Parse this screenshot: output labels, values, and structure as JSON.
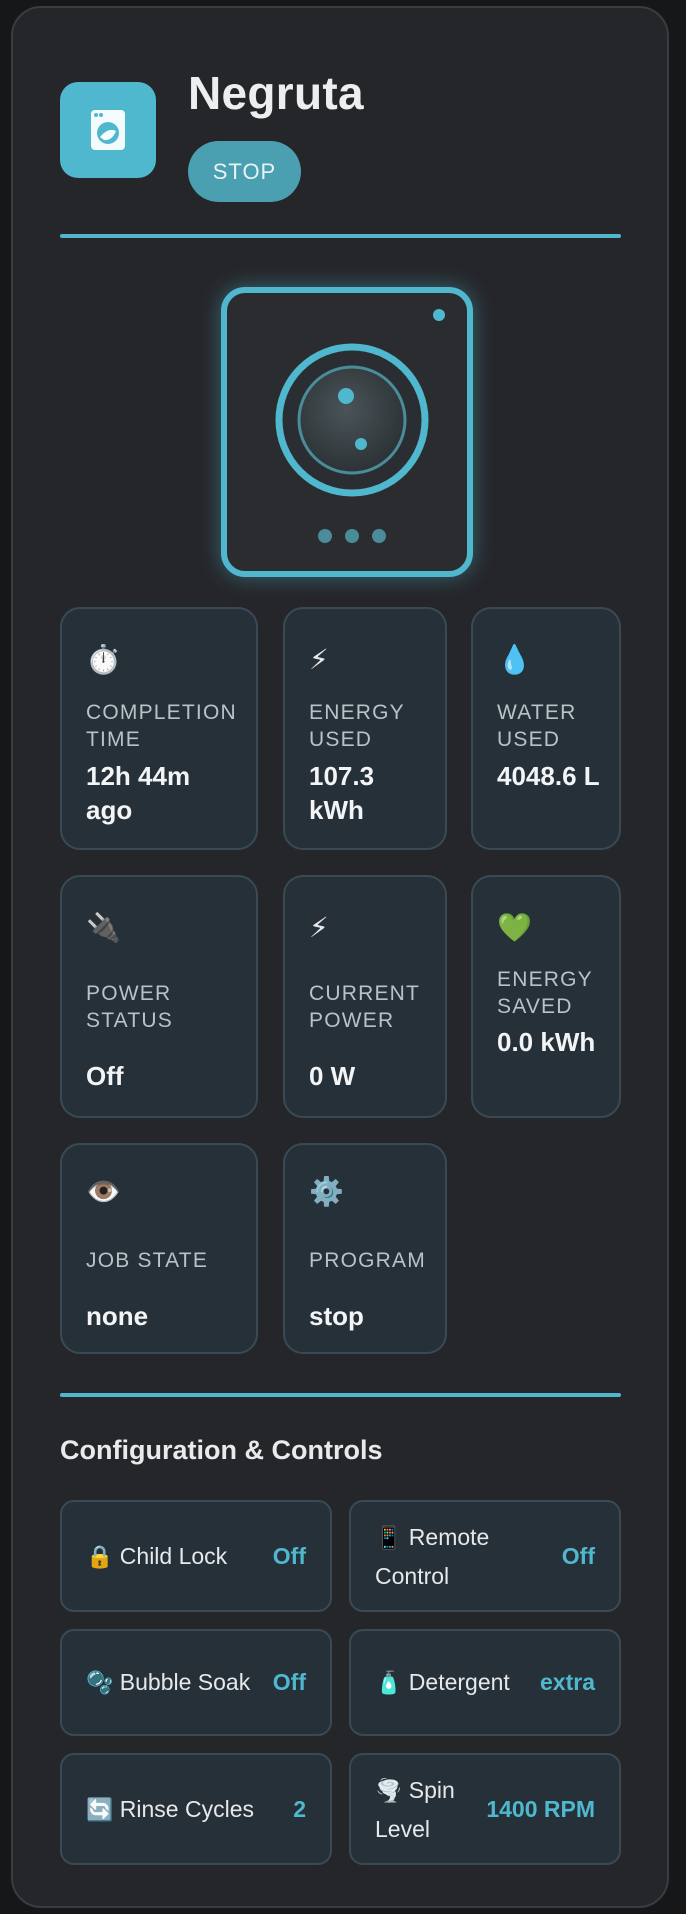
{
  "header": {
    "title": "Negruta",
    "stop_label": "STOP"
  },
  "stats": [
    {
      "icon": "⏱️",
      "label": "COMPLETION TIME",
      "value": "12h 44m ago"
    },
    {
      "icon": "⚡",
      "label": "ENERGY USED",
      "value": "107.3 kWh"
    },
    {
      "icon": "💧",
      "label": "WATER USED",
      "value": "4048.6 L"
    },
    {
      "icon": "🔌",
      "label": "POWER STATUS",
      "value": "Off"
    },
    {
      "icon": "⚡",
      "label": "CURRENT POWER",
      "value": "0 W"
    },
    {
      "icon": "💚",
      "label": "ENERGY SAVED",
      "value": "0.0 kWh"
    },
    {
      "icon": "👁️",
      "label": "JOB STATE",
      "value": "none"
    },
    {
      "icon": "⚙️",
      "label": "PROGRAM",
      "value": "stop"
    }
  ],
  "config": {
    "title": "Configuration & Controls",
    "items": [
      {
        "icon": "🔒",
        "label": "Child Lock",
        "value": "Off"
      },
      {
        "icon": "📱",
        "label": "Remote Control",
        "value": "Off"
      },
      {
        "icon": "🫧",
        "label": "Bubble Soak",
        "value": "Off"
      },
      {
        "icon": "🧴",
        "label": "Detergent",
        "value": "extra"
      },
      {
        "icon": "🔄",
        "label": "Rinse Cycles",
        "value": "2"
      },
      {
        "icon": "🌪️",
        "label": "Spin Level",
        "value": "1400 RPM"
      }
    ]
  },
  "colors": {
    "accent": "#4fb8cf",
    "card_bg": "#25262a",
    "tile_bg": "#263038"
  },
  "icons": {
    "app": "washing-machine-icon"
  }
}
